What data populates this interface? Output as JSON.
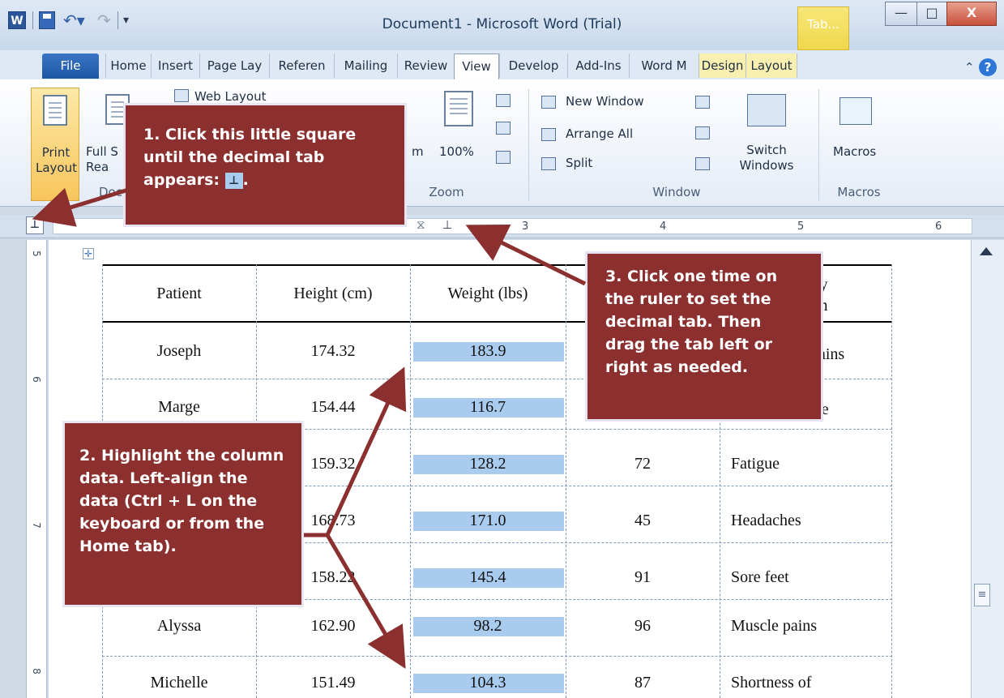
{
  "window": {
    "title": "Document1 - Microsoft Word (Trial)",
    "app_icon_text": "W",
    "contextual_tab_label": "Tab...",
    "minimize": "—",
    "maximize": "□",
    "close": "X"
  },
  "tabs": [
    "File",
    "Home",
    "Insert",
    "Page Lay",
    "Referen",
    "Mailing",
    "Review",
    "View",
    "Develop",
    "Add-Ins",
    "Word M",
    "Design",
    "Layout"
  ],
  "ribbon": {
    "print_layout": "Print Layout",
    "full_screen": "Full S Rea",
    "web_layout": "Web Layout",
    "document_views_group": "Doc",
    "zoom_partial": "m",
    "zoom_100": "100%",
    "zoom_group": "Zoom",
    "new_window": "New Window",
    "arrange_all": "Arrange All",
    "split": "Split",
    "switch_windows": "Switch Windows",
    "window_group": "Window",
    "macros": "Macros",
    "macros_group": "Macros"
  },
  "ruler": {
    "numbers": [
      "3",
      "4",
      "5",
      "6"
    ],
    "vertical_numbers": [
      "5",
      "6",
      "7",
      "8"
    ]
  },
  "table": {
    "headers": [
      "Patient",
      "Height (cm)",
      "Weight (lbs)",
      "ary om"
    ],
    "rows": [
      {
        "patient": "Joseph",
        "height": "174.32",
        "weight": "183.9",
        "col4": "",
        "symptom": "pains"
      },
      {
        "patient": "Marge",
        "height": "154.44",
        "weight": "116.7",
        "col4": "",
        "symptom": "se"
      },
      {
        "patient": "",
        "height": "159.32",
        "weight": "128.2",
        "col4": "72",
        "symptom": "Fatigue"
      },
      {
        "patient": "",
        "height": "168.73",
        "weight": "171.0",
        "col4": "45",
        "symptom": "Headaches"
      },
      {
        "patient": "",
        "height": "158.22",
        "weight": "145.4",
        "col4": "91",
        "symptom": "Sore feet"
      },
      {
        "patient": "Alyssa",
        "height": "162.90",
        "weight": "98.2",
        "col4": "96",
        "symptom": "Muscle pains"
      },
      {
        "patient": "Michelle",
        "height": "151.49",
        "weight": "104.3",
        "col4": "87",
        "symptom": "Shortness of"
      }
    ]
  },
  "callouts": {
    "step1": "1. Click this little square until the decimal tab appears:",
    "step2": "2. Highlight the column data. Left-align the data (Ctrl + L on the keyboard or from the Home tab).",
    "step3": "3. Click one time on the ruler to set the decimal tab. Then drag the tab left or right as needed."
  },
  "colors": {
    "callout_bg": "#8b2f2f",
    "highlight": "#a8cbee",
    "file_tab": "#1d55a4"
  }
}
